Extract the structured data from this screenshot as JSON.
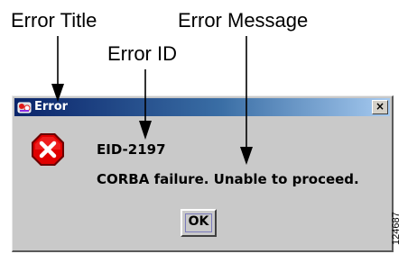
{
  "callouts": {
    "error_title": "Error Title",
    "error_id": "Error ID",
    "error_message": "Error Message"
  },
  "dialog": {
    "title": "Error",
    "close_label": "×",
    "error_id": "EID-2197",
    "message": "CORBA failure.  Unable to proceed.",
    "ok_label": "OK",
    "titlebar_color": "#0a246a",
    "background_color": "#c9c9c9",
    "error_icon_color": "#e00000"
  },
  "figure_number": "124687"
}
